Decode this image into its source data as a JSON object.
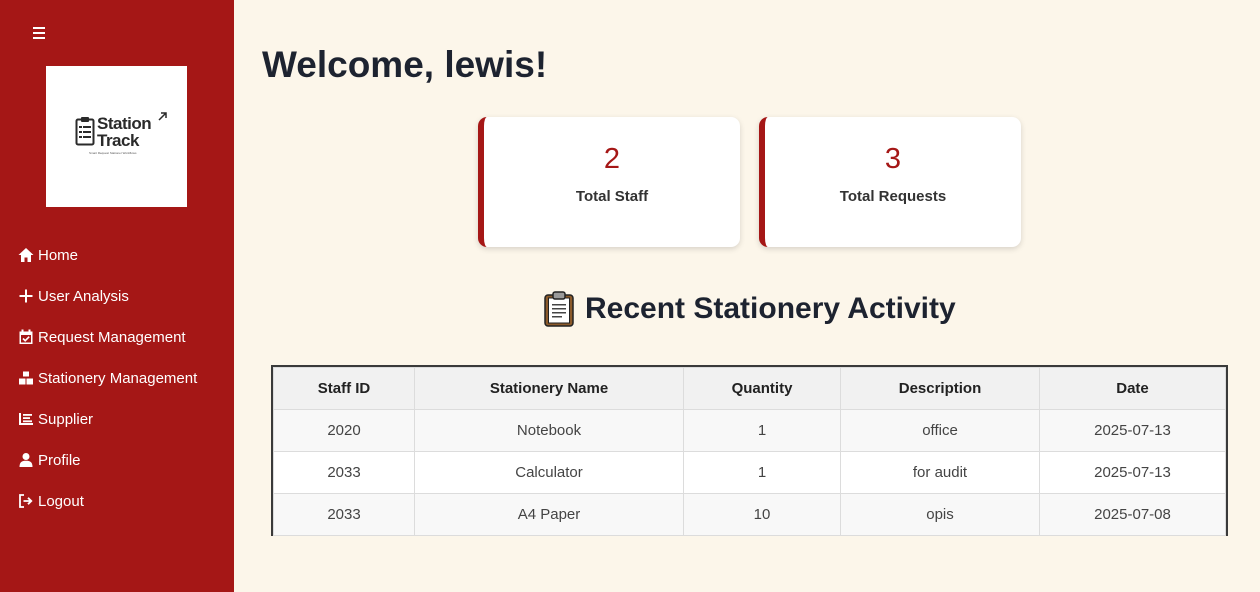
{
  "sidebar": {
    "logo": {
      "line1": "Station",
      "line2": "Track",
      "tagline": "Smart Request Stationer Workflows"
    },
    "items": [
      {
        "label": "Home",
        "icon": "home-icon"
      },
      {
        "label": "User Analysis",
        "icon": "plus-icon"
      },
      {
        "label": "Request Management",
        "icon": "calendar-check-icon"
      },
      {
        "label": "Stationery Management",
        "icon": "boxes-icon"
      },
      {
        "label": "Supplier",
        "icon": "list-icon"
      },
      {
        "label": "Profile",
        "icon": "user-icon"
      },
      {
        "label": "Logout",
        "icon": "logout-icon"
      }
    ]
  },
  "main": {
    "welcome": "Welcome, lewis!",
    "cards": [
      {
        "value": "2",
        "label": "Total Staff"
      },
      {
        "value": "3",
        "label": "Total Requests"
      }
    ],
    "section_title": "Recent Stationery Activity",
    "table": {
      "headers": [
        "Staff ID",
        "Stationery Name",
        "Quantity",
        "Description",
        "Date"
      ],
      "rows": [
        [
          "2020",
          "Notebook",
          "1",
          "office",
          "2025-07-13"
        ],
        [
          "2033",
          "Calculator",
          "1",
          "for audit",
          "2025-07-13"
        ],
        [
          "2033",
          "A4 Paper",
          "10",
          "opis",
          "2025-07-08"
        ]
      ]
    }
  },
  "colors": {
    "accent": "#a51716",
    "background": "#fcf6ea"
  }
}
